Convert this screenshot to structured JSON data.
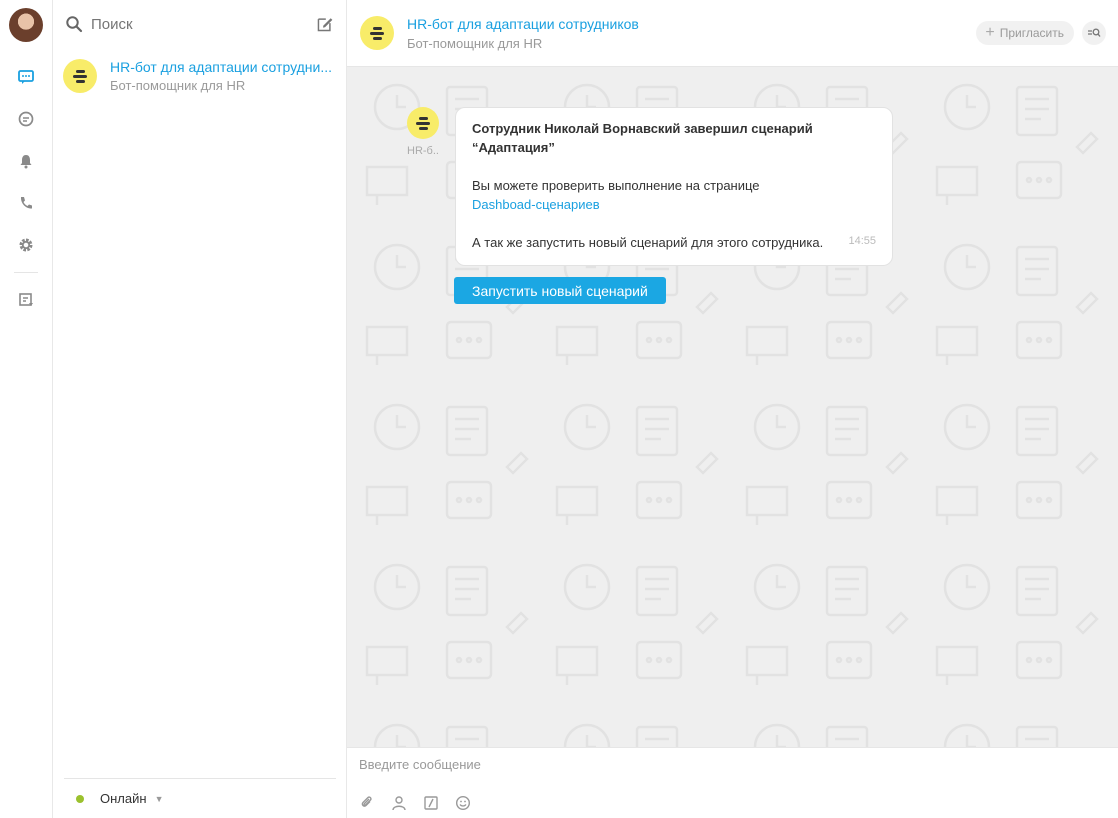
{
  "search": {
    "placeholder": "Поиск"
  },
  "chats": [
    {
      "name": "HR-бот для адаптации сотрудни...",
      "subtitle": "Бот-помощник для HR"
    }
  ],
  "status": {
    "label": "Онлайн",
    "color": "#9bc12e"
  },
  "conversation": {
    "title": "HR-бот для адаптации сотрудников",
    "subtitle": "Бот-помощник для HR",
    "invite_label": "Пригласить"
  },
  "message": {
    "author": "HR-б..",
    "line_bold_1": "Сотрудник Николай Ворнавский завершил сценарий",
    "line_bold_2": "“Адаптация”",
    "line_1": "Вы можете проверить выполнение на странице",
    "link": "Dashboad-сценариев",
    "line_2": "А так же запустить новый сценарий для этого сотрудника.",
    "time": "14:55",
    "action_label": "Запустить новый сценарий"
  },
  "composer": {
    "placeholder": "Введите сообщение"
  },
  "colors": {
    "accent": "#1aa0e0",
    "bot_avatar": "#f8ec69",
    "button": "#1ba7e3"
  }
}
